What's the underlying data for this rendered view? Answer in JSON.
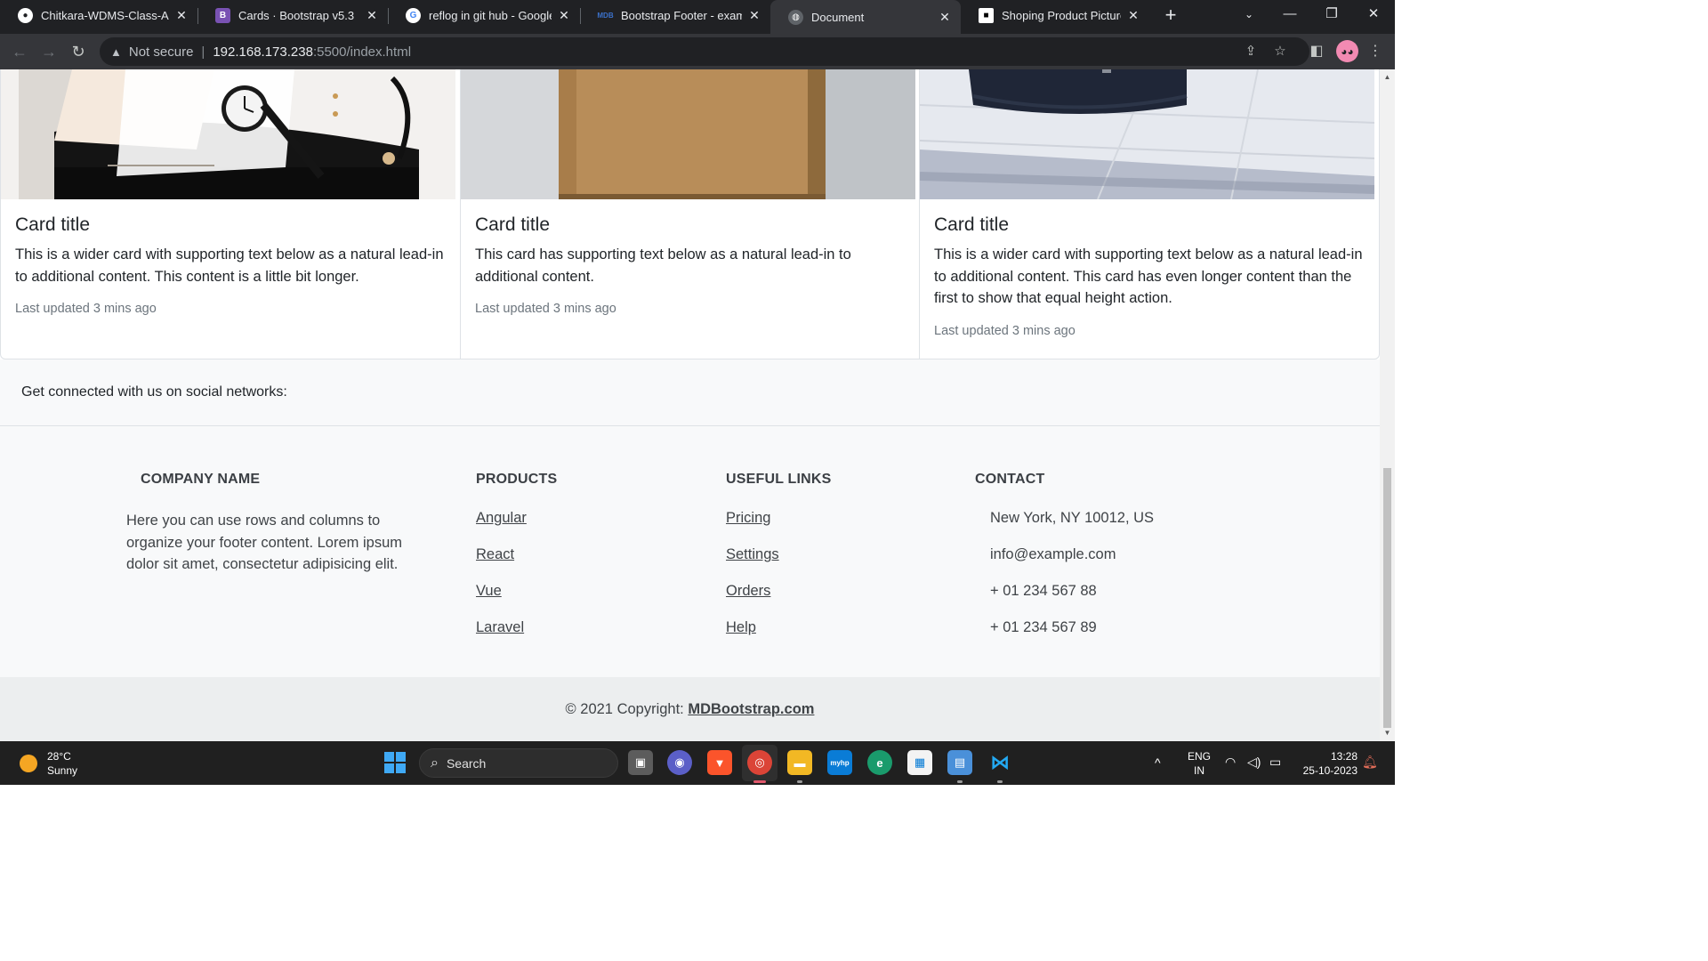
{
  "browser": {
    "tabs": [
      {
        "title": "Chitkara-WDMS-Class-Assi",
        "icon": "github-icon"
      },
      {
        "title": "Cards · Bootstrap v5.3",
        "icon": "bootstrap-icon"
      },
      {
        "title": "reflog in git hub - Google S",
        "icon": "google-icon"
      },
      {
        "title": "Bootstrap Footer - example",
        "icon": "mdb-icon"
      },
      {
        "title": "Document",
        "icon": "globe-icon"
      },
      {
        "title": "Shoping Product Pictures |",
        "icon": "unsplash-icon"
      }
    ],
    "active_tab_index": 4,
    "security_label": "Not secure",
    "url_host": "192.168.173.238",
    "url_path": ":5500/index.html"
  },
  "cards": [
    {
      "title": "Card title",
      "text": "This is a wider card with supporting text below as a natural lead-in to additional content. This content is a little bit longer.",
      "updated": "Last updated 3 mins ago"
    },
    {
      "title": "Card title",
      "text": "This card has supporting text below as a natural lead-in to additional content.",
      "updated": "Last updated 3 mins ago"
    },
    {
      "title": "Card title",
      "text": "This is a wider card with supporting text below as a natural lead-in to additional content. This card has even longer content than the first to show that equal height action.",
      "updated": "Last updated 3 mins ago"
    }
  ],
  "social": {
    "text": "Get connected with us on social networks:"
  },
  "footer": {
    "company": {
      "heading": "COMPANY NAME",
      "text": "Here you can use rows and columns to organize your footer content. Lorem ipsum dolor sit amet, consectetur adipisicing elit."
    },
    "products": {
      "heading": "PRODUCTS",
      "links": [
        "Angular",
        "React",
        "Vue",
        "Laravel"
      ]
    },
    "useful": {
      "heading": "USEFUL LINKS",
      "links": [
        "Pricing",
        "Settings",
        "Orders",
        "Help"
      ]
    },
    "contact": {
      "heading": "CONTACT",
      "items": [
        "New York, NY 10012, US",
        "info@example.com",
        "+ 01 234 567 88",
        "+ 01 234 567 89"
      ]
    },
    "copyright_prefix": "© 2021 Copyright: ",
    "copyright_link": "MDBootstrap.com"
  },
  "taskbar": {
    "weather_temp": "28°C",
    "weather_desc": "Sunny",
    "search_placeholder": "Search",
    "lang_top": "ENG",
    "lang_bottom": "IN",
    "time": "13:28",
    "date": "25-10-2023"
  },
  "colors": {
    "page_bg": "#ffffff",
    "footer_bg": "#f8f9fa",
    "copyright_bg": "#eceeef",
    "chrome_dark": "#202124",
    "taskbar_bg": "#202020"
  }
}
